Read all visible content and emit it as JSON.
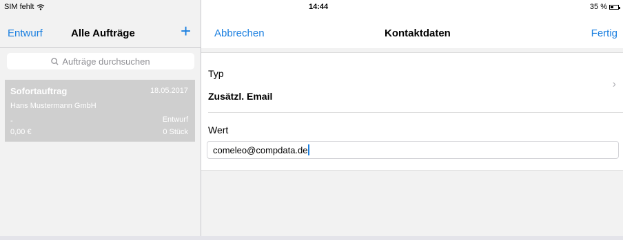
{
  "status": {
    "carrier": "SIM fehlt",
    "time": "14:44",
    "battery": "35 %",
    "wifi_icon": "wifi-icon",
    "battery_level": 0.35
  },
  "left_nav": {
    "back_label": "Entwurf",
    "title": "Alle Aufträge",
    "add_icon": "plus-icon"
  },
  "search": {
    "placeholder": "Aufträge durchsuchen",
    "icon": "search-icon"
  },
  "orders": [
    {
      "title": "Sofortauftrag",
      "date": "18.05.2017",
      "customer": "Hans Mustermann GmbH",
      "dash": "-",
      "status": "Entwurf",
      "price": "0,00 €",
      "qty": "0 Stück"
    }
  ],
  "right_nav": {
    "cancel_label": "Abbrechen",
    "title": "Kontaktdaten",
    "done_label": "Fertig"
  },
  "form": {
    "type_label": "Typ",
    "type_value": "Zusätzl. Email",
    "value_label": "Wert",
    "value_input": "comeleo@compdata.de"
  },
  "colors": {
    "accent": "#1a7fe0",
    "selected_row": "#cfcfcf",
    "background": "#f2f2f2"
  }
}
